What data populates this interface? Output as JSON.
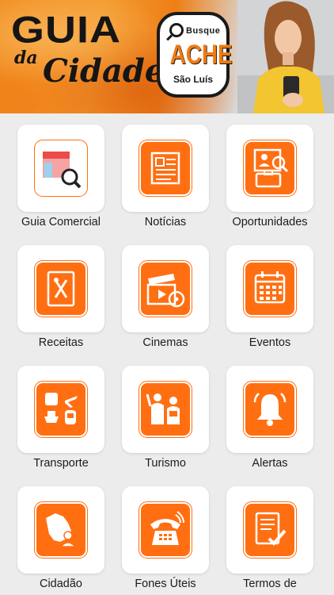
{
  "banner": {
    "title": "GUIA",
    "subtitle_small": "da",
    "subtitle_large": "Cidade",
    "logo": {
      "small_text": "Busque",
      "main_text": "ACHE",
      "city": "São Luís"
    }
  },
  "grid": {
    "accent_color": "#ff6f12",
    "items": [
      {
        "label": "Guia Comercial",
        "icon": "store-search-icon"
      },
      {
        "label": "Notícias",
        "icon": "newspaper-icon"
      },
      {
        "label": "Oportunidades",
        "icon": "job-search-icon"
      },
      {
        "label": "Receitas",
        "icon": "recipe-book-icon"
      },
      {
        "label": "Cinemas",
        "icon": "clapperboard-icon"
      },
      {
        "label": "Eventos",
        "icon": "calendar-icon"
      },
      {
        "label": "Transporte",
        "icon": "transport-icon"
      },
      {
        "label": "Turismo",
        "icon": "tourists-icon"
      },
      {
        "label": "Alertas",
        "icon": "bell-icon"
      },
      {
        "label": "Cidadão",
        "icon": "citizen-map-icon"
      },
      {
        "label": "Fones Úteis",
        "icon": "telephone-icon"
      },
      {
        "label": "Termos de",
        "icon": "terms-document-icon"
      }
    ]
  }
}
